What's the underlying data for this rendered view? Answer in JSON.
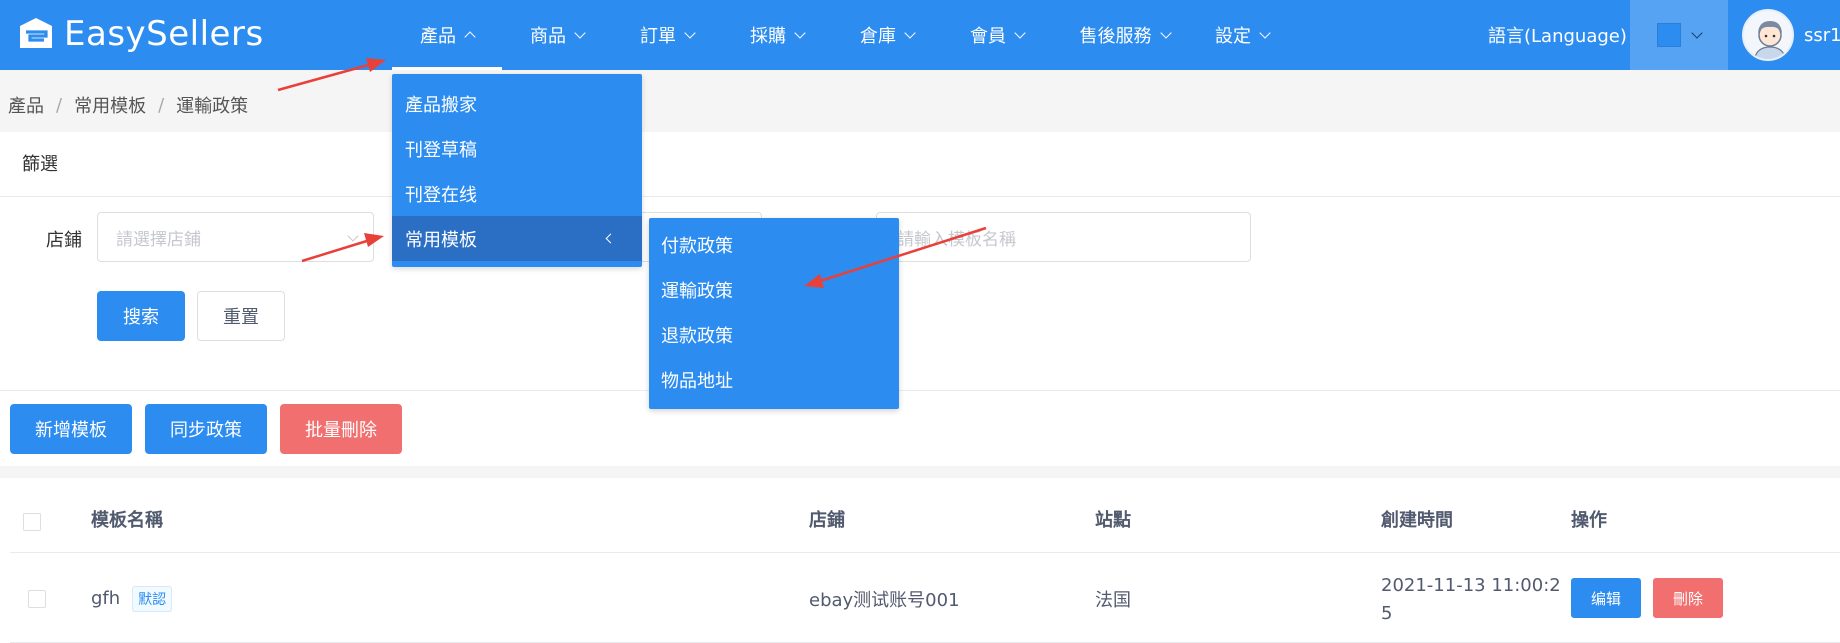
{
  "app": {
    "logo_text": "EasySellers"
  },
  "nav": {
    "items": [
      {
        "label": "產品",
        "active": true
      },
      {
        "label": "商品"
      },
      {
        "label": "訂單"
      },
      {
        "label": "採購"
      },
      {
        "label": "倉庫"
      },
      {
        "label": "會員"
      },
      {
        "label": "售後服務"
      },
      {
        "label": "設定"
      }
    ],
    "language_label": "語言(Language)",
    "theme_color": "#2d8cf0",
    "username": "ssr1"
  },
  "breadcrumb": [
    "產品",
    "常用模板",
    "運輸政策"
  ],
  "filter": {
    "title": "篩選",
    "store_label": "店鋪",
    "store_placeholder": "請選擇店鋪",
    "template_name_placeholder": "請輸入模板名稱",
    "search_label": "搜索",
    "reset_label": "重置"
  },
  "toolbar": {
    "add_label": "新增模板",
    "sync_label": "同步政策",
    "batch_delete_label": "批量刪除"
  },
  "table": {
    "headers": [
      "模板名稱",
      "店鋪",
      "站點",
      "創建時間",
      "操作"
    ],
    "rows": [
      {
        "name": "gfh",
        "tag": "默認",
        "store": "ebay测试账号001",
        "site": "法国",
        "created_line1": "2021-11-13 11:00:2",
        "created_line2": "5",
        "edit_label": "编辑",
        "delete_label": "刪除"
      }
    ]
  },
  "product_menu": {
    "items": [
      "產品搬家",
      "刊登草稿",
      "刊登在线",
      "常用模板"
    ],
    "hovered": "常用模板"
  },
  "template_submenu": {
    "items": [
      "付款政策",
      "運輸政策",
      "退款政策",
      "物品地址"
    ]
  },
  "colors": {
    "primary": "#2d8cf0",
    "danger": "#f16f6f",
    "annotation_arrow": "#e8413a"
  }
}
